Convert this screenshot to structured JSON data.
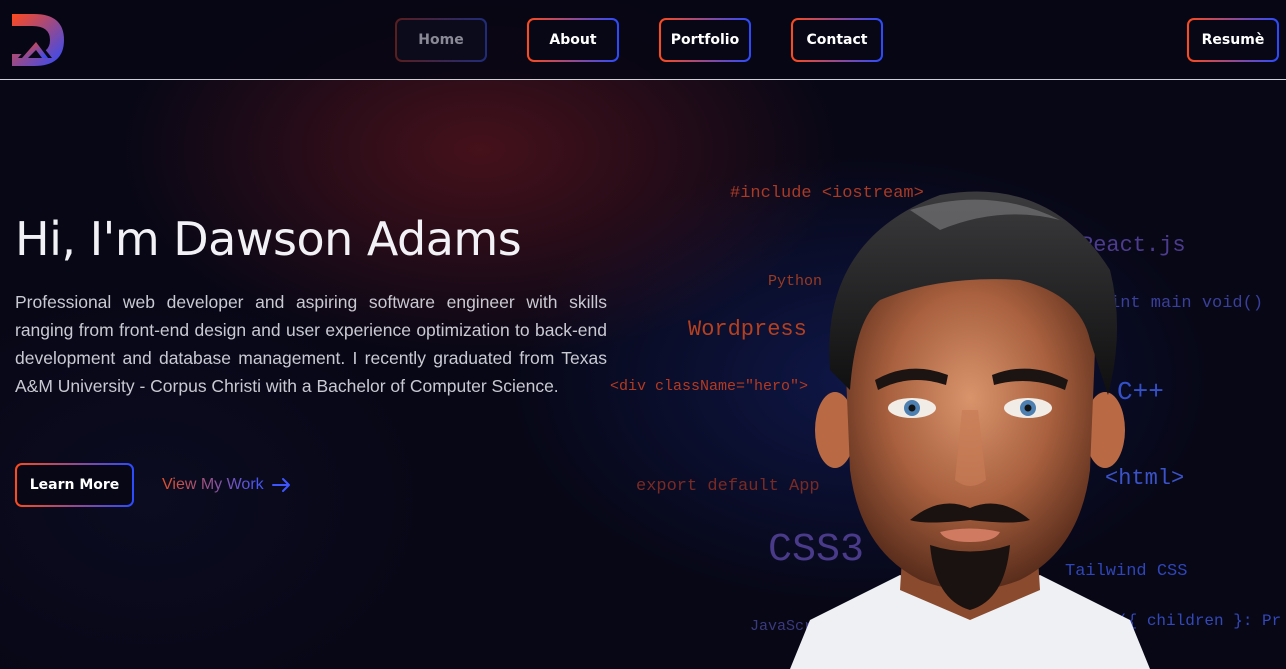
{
  "nav": {
    "logo": "DA logo",
    "home": "Home",
    "about": "About",
    "portfolio": "Portfolio",
    "contact": "Contact",
    "resume": "Resumè"
  },
  "hero": {
    "title": "Hi, I'm Dawson Adams",
    "description": "Professional web developer and aspiring software engineer with skills ranging from front-end design and user experience optimization to back-end development and database management. I recently graduated from Texas A&M University - Corpus Christi with a Bachelor of Computer Science.",
    "learn_more": "Learn More",
    "view_work": "View My Work",
    "view_work_icon": "arrow-right-icon"
  },
  "code_snippets": {
    "include": "#include <iostream>",
    "react": "React.js",
    "python": "Python",
    "int_main": "int main void()",
    "wordpress": "Wordpress",
    "div_hero": "<div className=\"hero\">",
    "cpp": "C++",
    "html": "<html>",
    "export": "export default App",
    "css3": "CSS3",
    "tailwind": "Tailwind CSS",
    "javascript": "JavaScript",
    "button": "utton({ children }: Pr"
  },
  "colors": {
    "accent_orange": "#ff4a1c",
    "accent_blue": "#2b4bff",
    "background": "#070716"
  }
}
